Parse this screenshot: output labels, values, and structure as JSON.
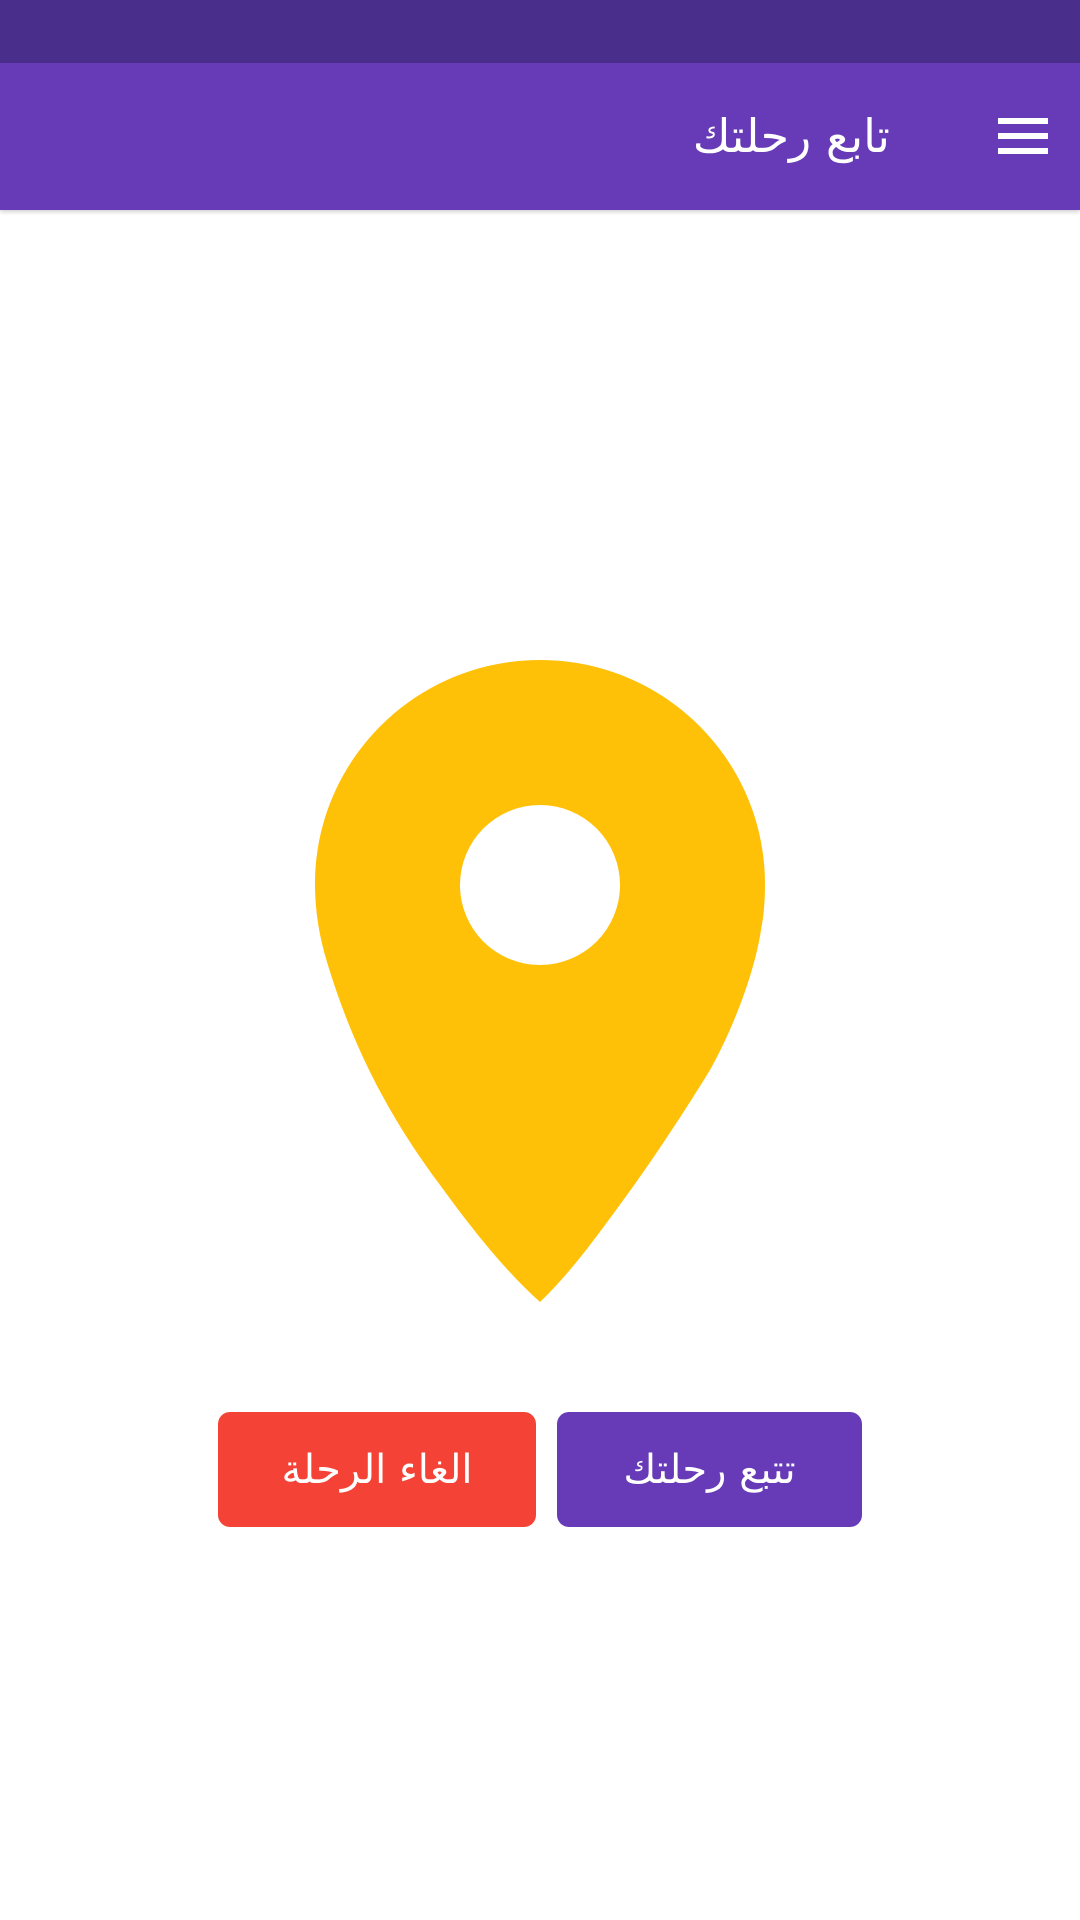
{
  "app_bar": {
    "title": "تابع رحلتك",
    "menu_icon": "menu-icon"
  },
  "main": {
    "pin_icon": "location-pin-icon",
    "pin_color": "#ffc107"
  },
  "actions": {
    "cancel_label": "الغاء الرحلة",
    "track_label": "تتبع رحلتك"
  },
  "colors": {
    "primary": "#673ab7",
    "status_bar": "#4a2e8c",
    "danger": "#f44336",
    "accent": "#ffc107"
  }
}
